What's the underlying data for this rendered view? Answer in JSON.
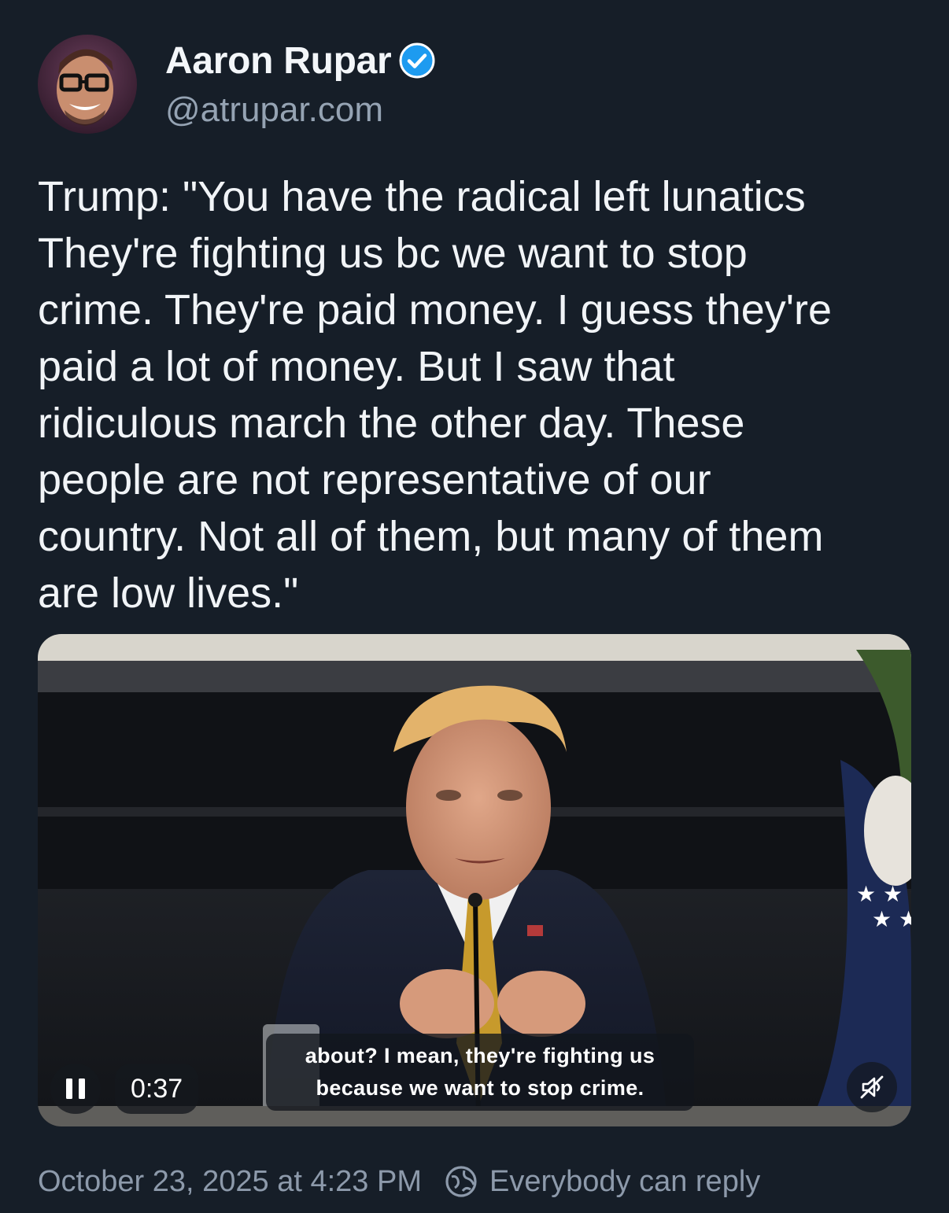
{
  "author": {
    "display_name": "Aaron Rupar",
    "handle": "@atrupar.com",
    "verified_icon": "verified-check-icon",
    "avatar": "user-avatar"
  },
  "post": {
    "text": "Trump: \"You have the radical left lunatics\nThey're fighting us bc we want to stop\ncrime. They're paid money. I guess they're\npaid a lot of money. But I saw that\nridiculous march the other day. These\npeople are not representative of our\ncountry. Not all of them, but many of them\nare low lives.\""
  },
  "video": {
    "elapsed": "0:37",
    "caption_line1": "about? I mean, they're fighting us",
    "caption_line2": "because we want to stop crime.",
    "pause_icon": "pause-icon",
    "mute_icon": "speaker-muted-icon"
  },
  "footer": {
    "date": "October 23, 2025 at 4:23 PM",
    "reply_setting": "Everybody can reply",
    "reply_icon": "globe-icon"
  },
  "colors": {
    "background": "#161e28",
    "verified_blue": "#1d9bf0",
    "muted_text": "#8d9aab"
  }
}
